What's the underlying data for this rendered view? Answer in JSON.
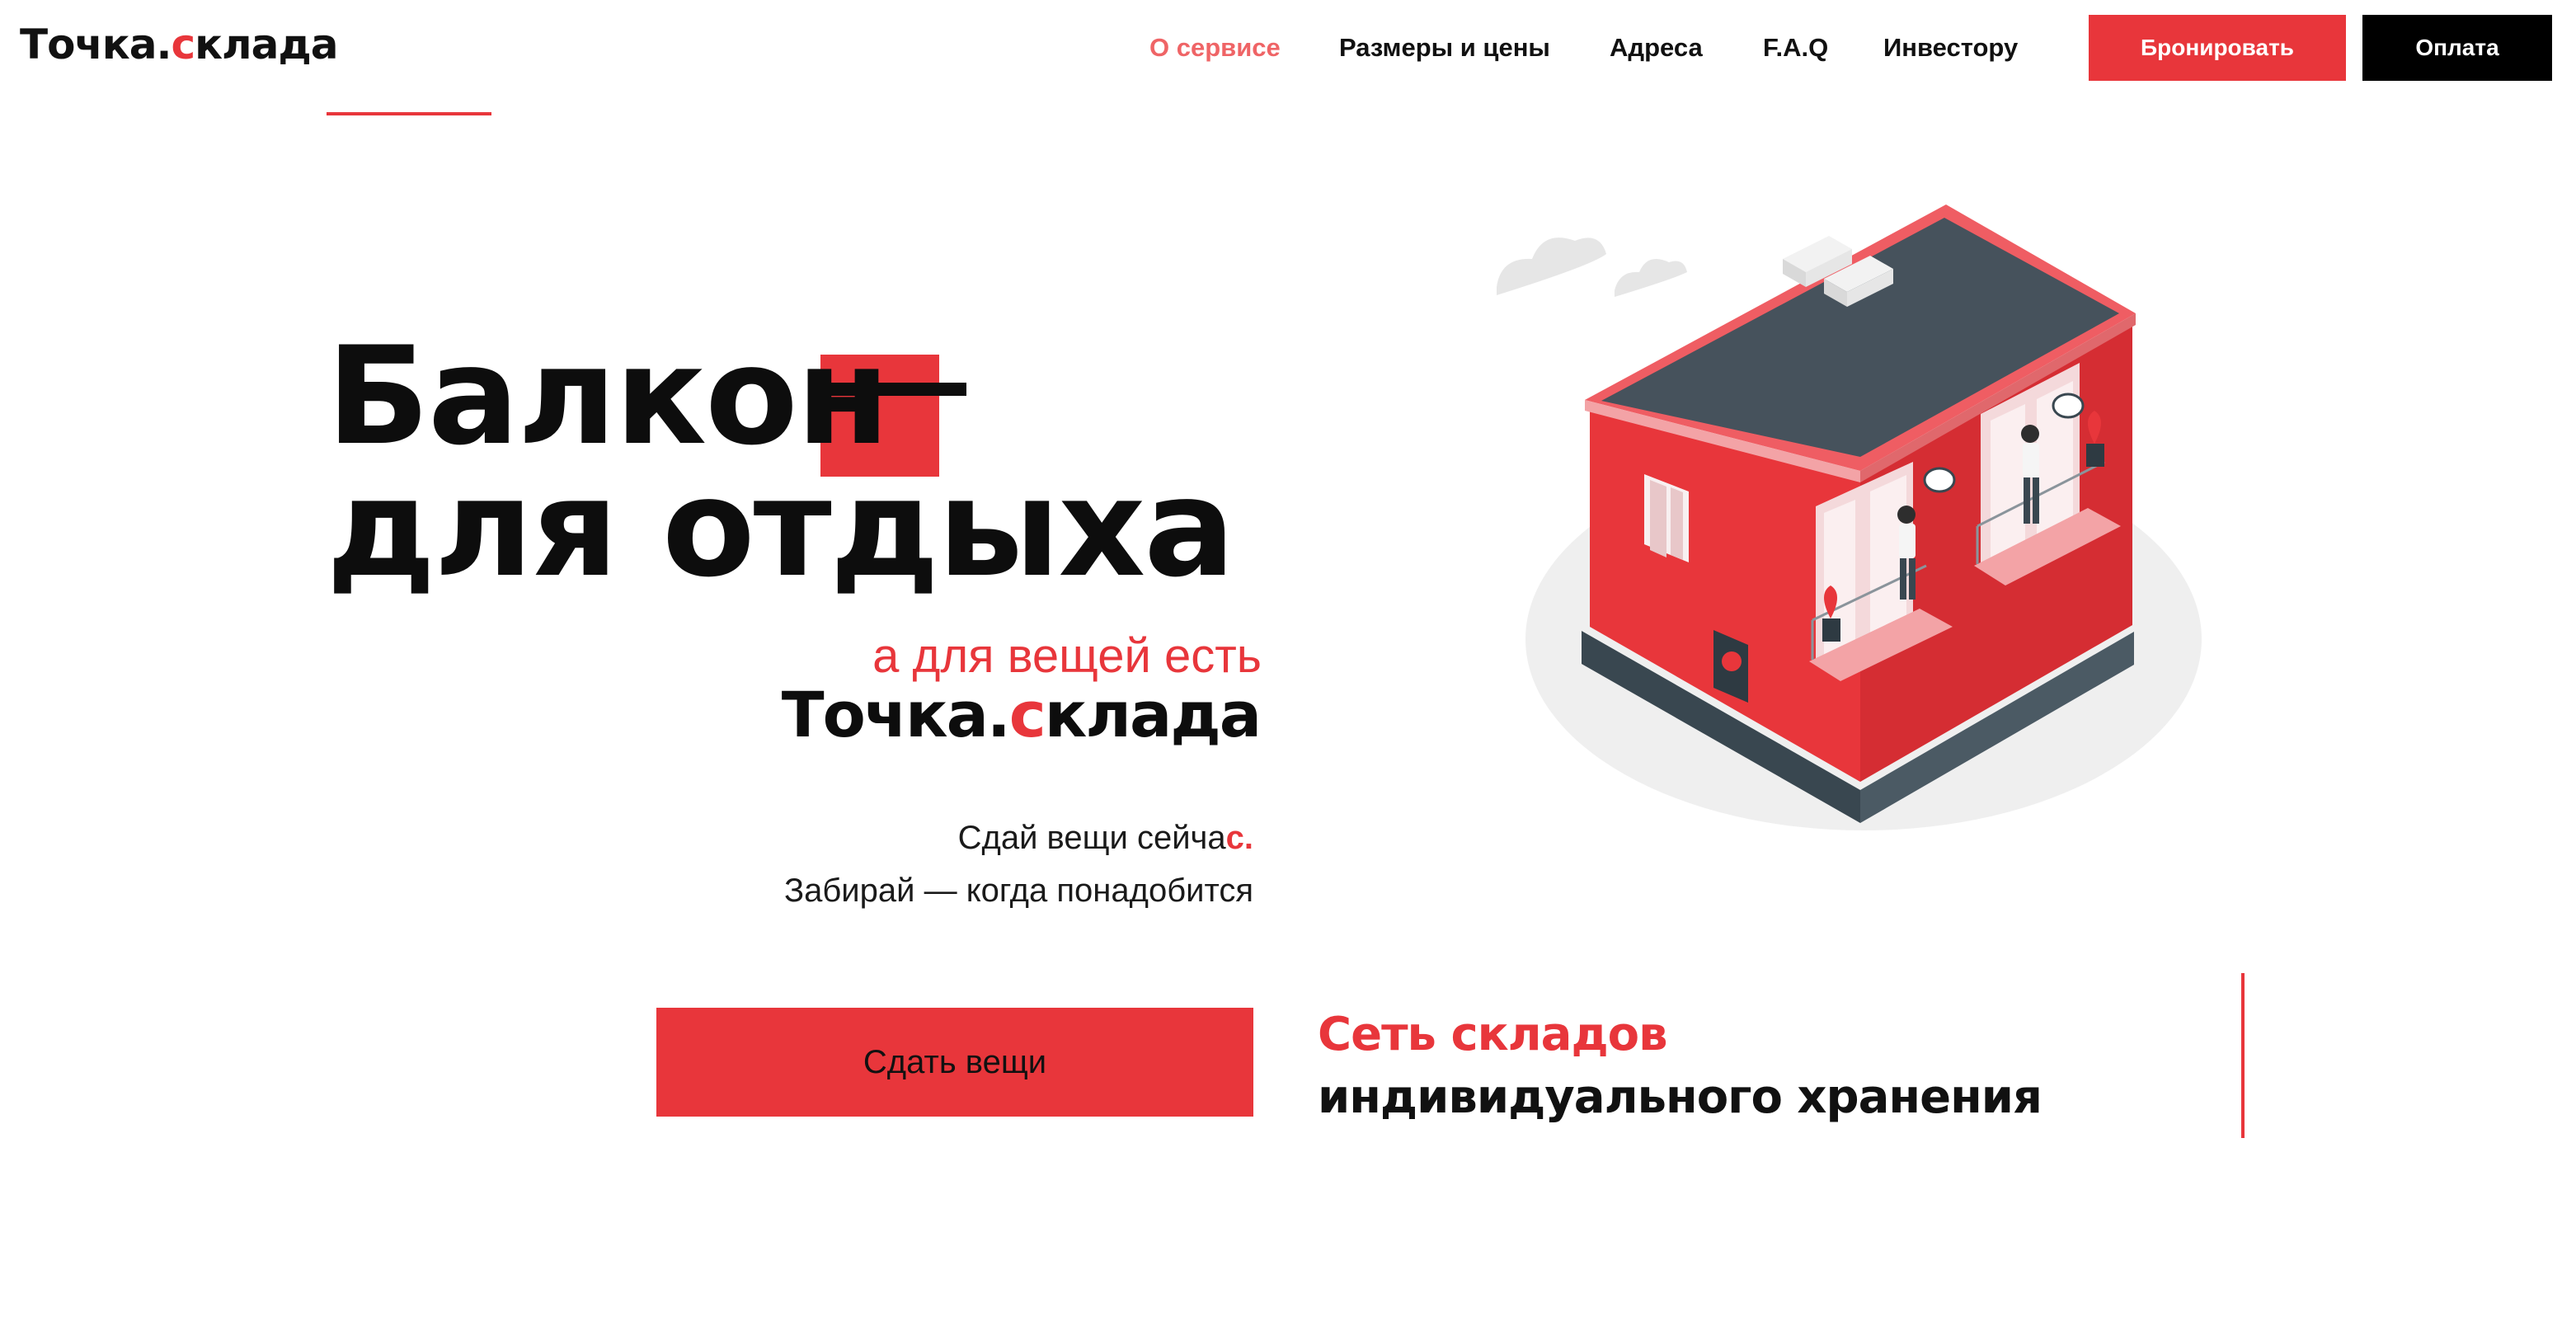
{
  "header": {
    "logo": {
      "part1": "Точка.",
      "accent": "с",
      "part2": "клада"
    },
    "nav": [
      {
        "label": "О сервисе",
        "active": true
      },
      {
        "label": "Размеры и цены"
      },
      {
        "label": "Адреса"
      },
      {
        "label": "F.A.Q"
      },
      {
        "label": "Инвестору"
      }
    ],
    "book_label": "Бронировать",
    "pay_label": "Оплата"
  },
  "hero": {
    "line1": "Балкон",
    "line2": "для отдыха",
    "tagline_pre": "а для вещей есть",
    "brand": {
      "part1": "Точка.",
      "accent": "с",
      "part2": "клада"
    },
    "sub_line1": {
      "text": "Сдай вещи сейча",
      "accent": "с."
    },
    "sub_line2": "Забирай — когда понадобится",
    "cta_label": "Сдать вещи",
    "network_line1": "Сеть складов",
    "network_line2": "индивидуального хранения"
  },
  "illustration": {
    "icon": "isometric-building-illustration"
  },
  "colors": {
    "accent": "#e8363b",
    "nav_active": "#ef6466",
    "dark": "#000000"
  }
}
